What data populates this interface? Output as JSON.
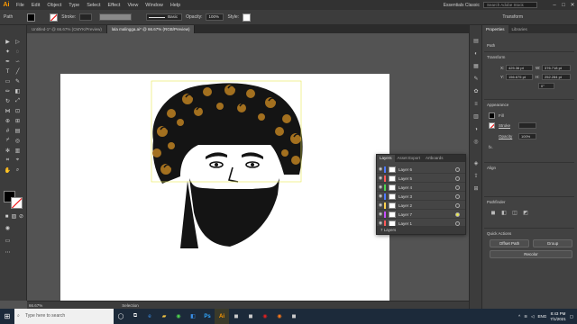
{
  "app": {
    "logo": "Ai",
    "menu": [
      "File",
      "Edit",
      "Object",
      "Type",
      "Select",
      "Effect",
      "View",
      "Window",
      "Help"
    ],
    "workspace": "Essentials Classic",
    "search_placeholder": "Search Adobe Stock"
  },
  "control": {
    "selection": "Path",
    "stroke_label": "Stroke:",
    "brush_label": "Basic",
    "opacity_label": "Opacity:",
    "opacity_value": "100%",
    "style_label": "Style:",
    "transform_label": "Transform"
  },
  "tabs": [
    {
      "label": "Untitled-1* @ 66.67% (CMYK/Preview)",
      "active": false
    },
    {
      "label": "lala malingga.ai* @ 66.67% (RGB/Preview)",
      "active": true
    }
  ],
  "status": {
    "zoom": "66.67%",
    "tool": "Selection"
  },
  "properties": {
    "tabs": [
      "Properties",
      "Libraries"
    ],
    "kind": "Path",
    "transform_title": "Transform",
    "x_label": "X:",
    "x_value": "425.36 pt",
    "w_label": "W:",
    "w_value": "376.718 pt",
    "y_label": "Y:",
    "y_value": "156.675 pt",
    "h_label": "H:",
    "h_value": "252.284 pt",
    "angle_value": "0°",
    "appearance_title": "Appearance",
    "fill_label": "Fill",
    "stroke_label": "Stroke",
    "opacity_label": "Opacity",
    "opacity_value": "100%",
    "fx_label": "fx.",
    "align_title": "Align",
    "pathfinder_title": "Pathfinder",
    "quick_title": "Quick Actions",
    "offset_path": "Offset Path",
    "group": "Group",
    "recolor": "Recolor"
  },
  "layers": {
    "tabs": [
      "Layers",
      "Asset Export",
      "Artboards"
    ],
    "rows": [
      {
        "name": "Layer 6",
        "color": "#4f7bff"
      },
      {
        "name": "Layer 5",
        "color": "#ff5a5a"
      },
      {
        "name": "Layer 4",
        "color": "#4fd64f"
      },
      {
        "name": "Layer 3",
        "color": "#4f7bff"
      },
      {
        "name": "Layer 2",
        "color": "#ffd24f"
      },
      {
        "name": "Layer 7",
        "color": "#c84fff"
      },
      {
        "name": "Layer 1",
        "color": "#ff5a5a"
      }
    ],
    "count": "7 Layers"
  },
  "taskbar": {
    "search_placeholder": "Type here to search",
    "lang": "ENG",
    "time": "8:43 PM",
    "date": "7/1/2021"
  },
  "colors": {
    "hair_brown": "#a3701f",
    "hair_dark": "#141414",
    "accent": "#ff9a00"
  }
}
